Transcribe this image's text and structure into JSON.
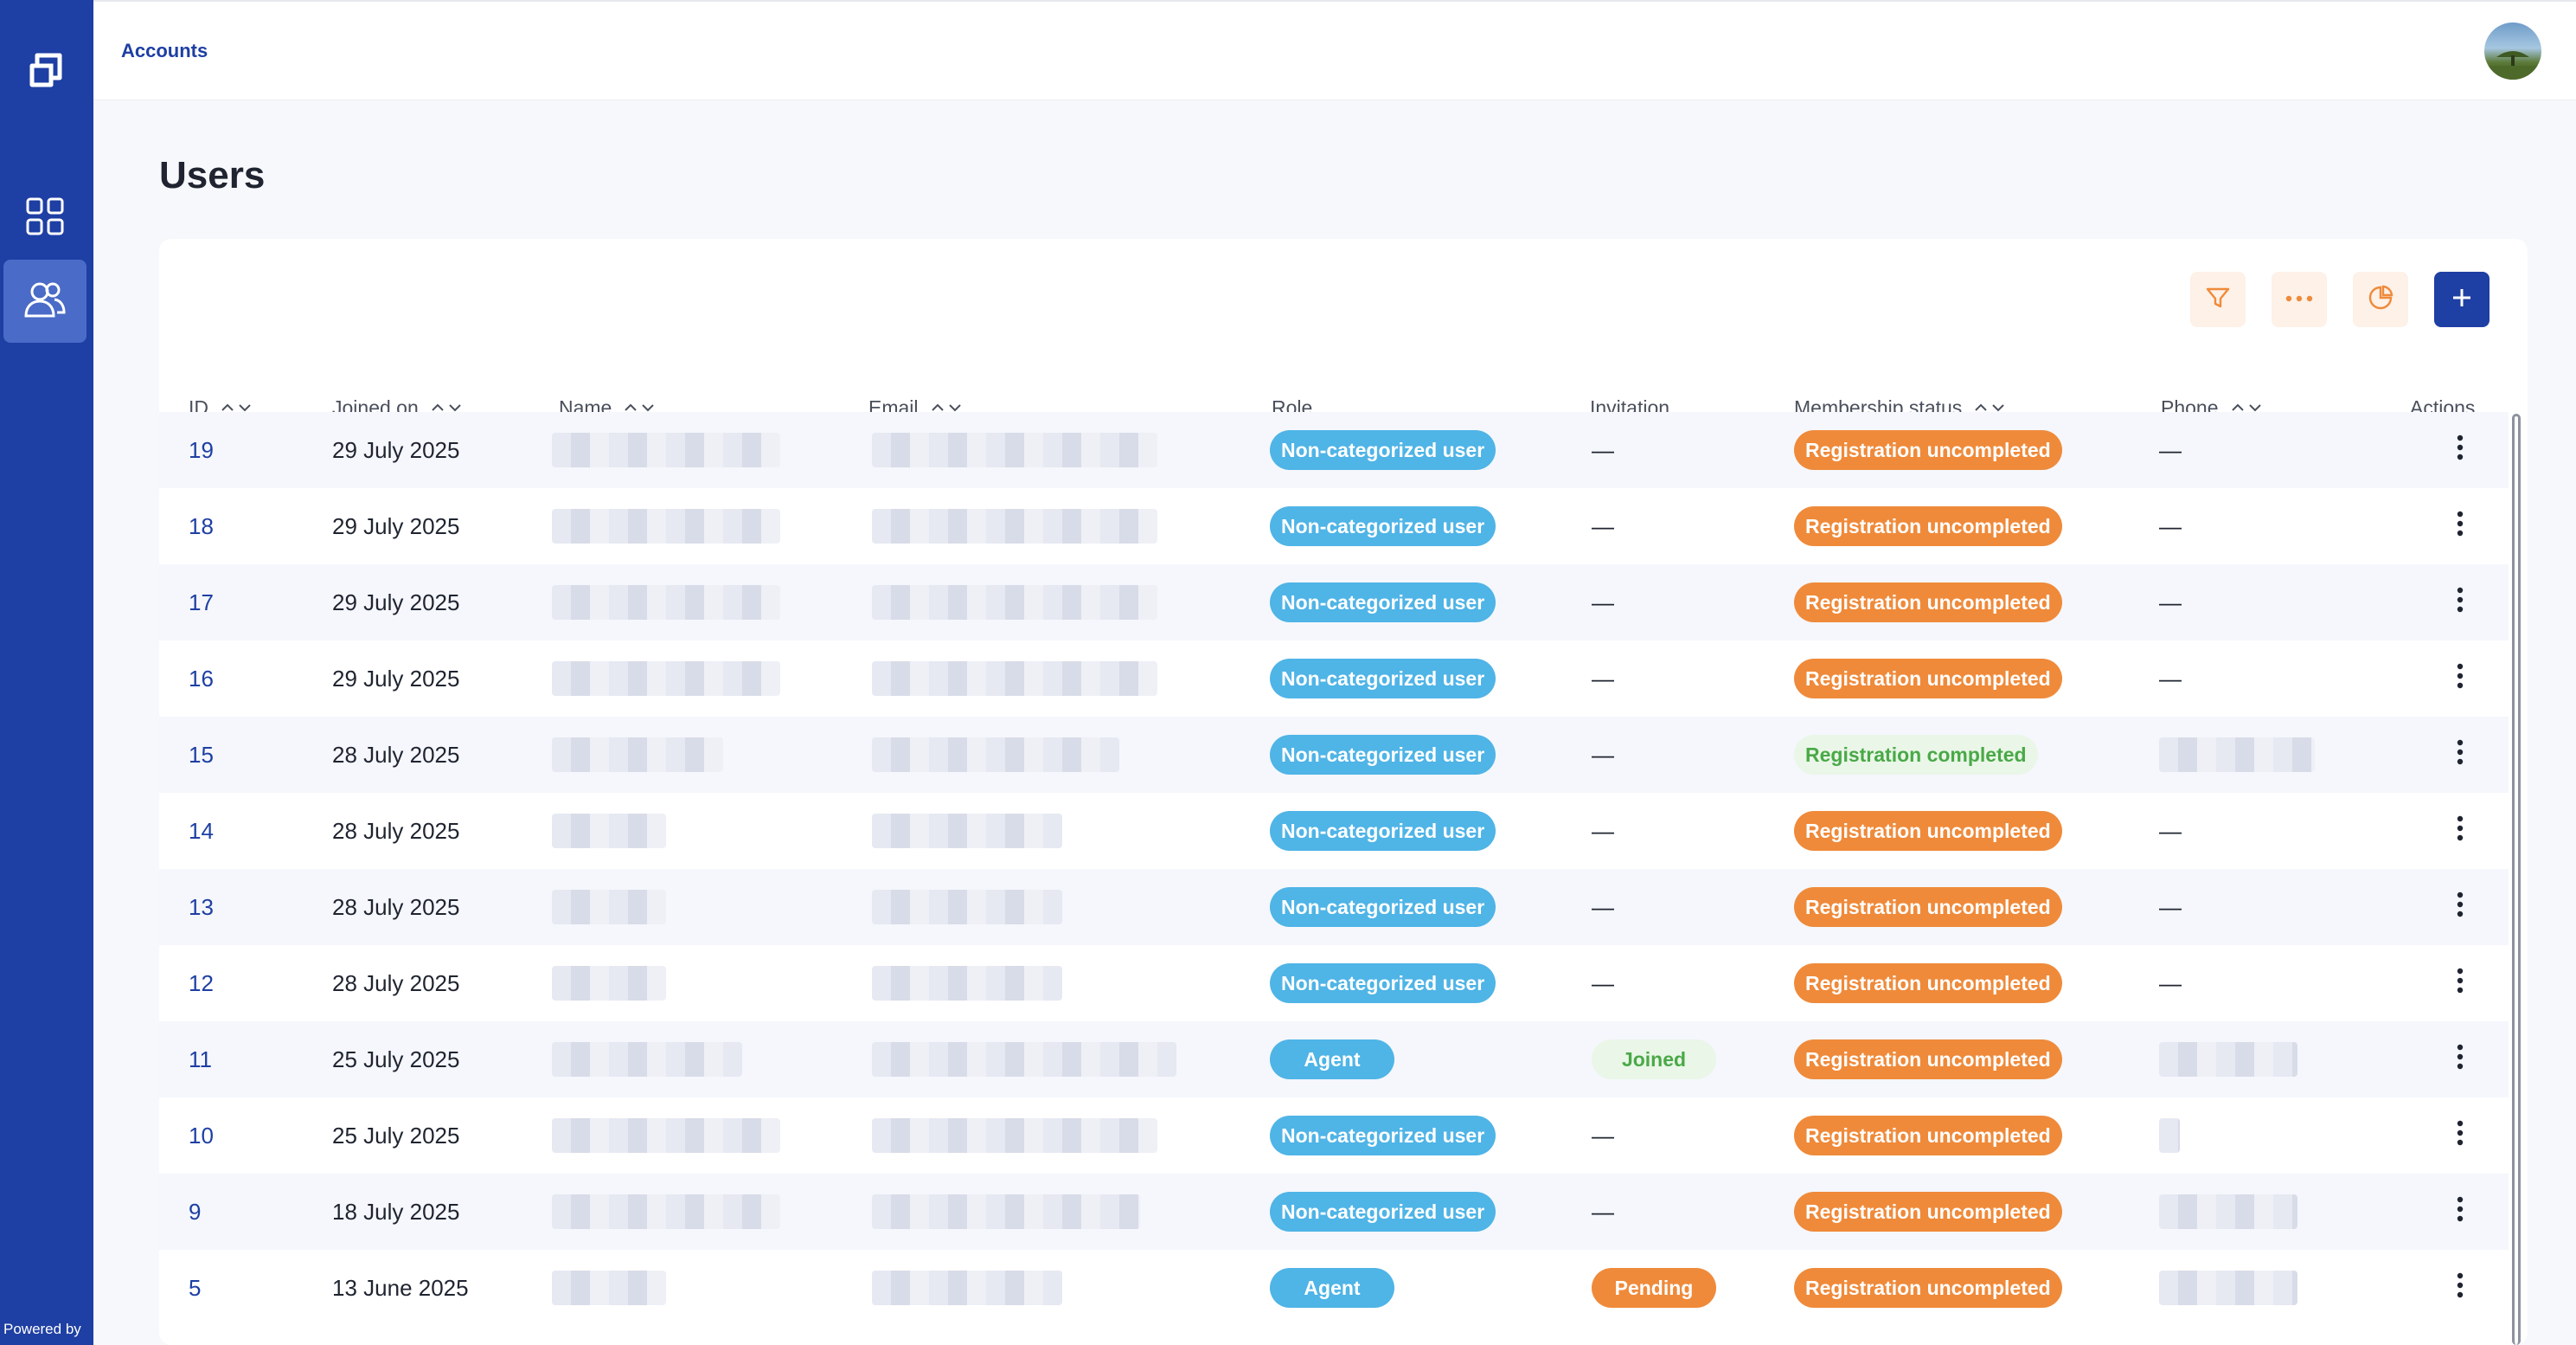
{
  "app": {
    "breadcrumb": "Accounts",
    "powered_by": "Powered by"
  },
  "page": {
    "title": "Users"
  },
  "sidebar": {
    "items": [
      {
        "name": "dashboard",
        "icon": "grid-icon",
        "active": false
      },
      {
        "name": "users",
        "icon": "users-icon",
        "active": true
      }
    ]
  },
  "toolbar": {
    "buttons": [
      {
        "icon": "filter-icon"
      },
      {
        "icon": "more-icon"
      },
      {
        "icon": "pie-chart-icon"
      },
      {
        "icon": "plus-icon"
      }
    ]
  },
  "colors": {
    "brand": "#1e3fa3",
    "role_pill": "#4fb4e6",
    "status_uncompleted": "#ef8a3a",
    "status_completed": "#49a947"
  },
  "table": {
    "columns": {
      "id": "ID",
      "joined": "Joined on",
      "name": "Name",
      "email": "Email",
      "role": "Role",
      "invitation": "Invitation",
      "membership": "Membership status",
      "phone": "Phone",
      "actions": "Actions"
    },
    "rows": [
      {
        "id": "19",
        "joined": "29 July 2025",
        "role": "Non-categorized user",
        "invitation": "—",
        "status": "Registration uncompleted",
        "phone": "—"
      },
      {
        "id": "18",
        "joined": "29 July 2025",
        "role": "Non-categorized user",
        "invitation": "—",
        "status": "Registration uncompleted",
        "phone": "—"
      },
      {
        "id": "17",
        "joined": "29 July 2025",
        "role": "Non-categorized user",
        "invitation": "—",
        "status": "Registration uncompleted",
        "phone": "—"
      },
      {
        "id": "16",
        "joined": "29 July 2025",
        "role": "Non-categorized user",
        "invitation": "—",
        "status": "Registration uncompleted",
        "phone": "—"
      },
      {
        "id": "15",
        "joined": "28 July 2025",
        "role": "Non-categorized user",
        "invitation": "—",
        "status": "Registration completed",
        "phone": ""
      },
      {
        "id": "14",
        "joined": "28 July 2025",
        "role": "Non-categorized user",
        "invitation": "—",
        "status": "Registration uncompleted",
        "phone": "—"
      },
      {
        "id": "13",
        "joined": "28 July 2025",
        "role": "Non-categorized user",
        "invitation": "—",
        "status": "Registration uncompleted",
        "phone": "—"
      },
      {
        "id": "12",
        "joined": "28 July 2025",
        "role": "Non-categorized user",
        "invitation": "—",
        "status": "Registration uncompleted",
        "phone": "—"
      },
      {
        "id": "11",
        "joined": "25 July 2025",
        "role": "Agent",
        "invitation": "Joined",
        "status": "Registration uncompleted",
        "phone": ""
      },
      {
        "id": "10",
        "joined": "25 July 2025",
        "role": "Non-categorized user",
        "invitation": "—",
        "status": "Registration uncompleted",
        "phone": ""
      },
      {
        "id": "9",
        "joined": "18 July 2025",
        "role": "Non-categorized user",
        "invitation": "—",
        "status": "Registration uncompleted",
        "phone": ""
      },
      {
        "id": "5",
        "joined": "13 June 2025",
        "role": "Agent",
        "invitation": "Pending",
        "status": "Registration uncompleted",
        "phone": ""
      }
    ]
  }
}
